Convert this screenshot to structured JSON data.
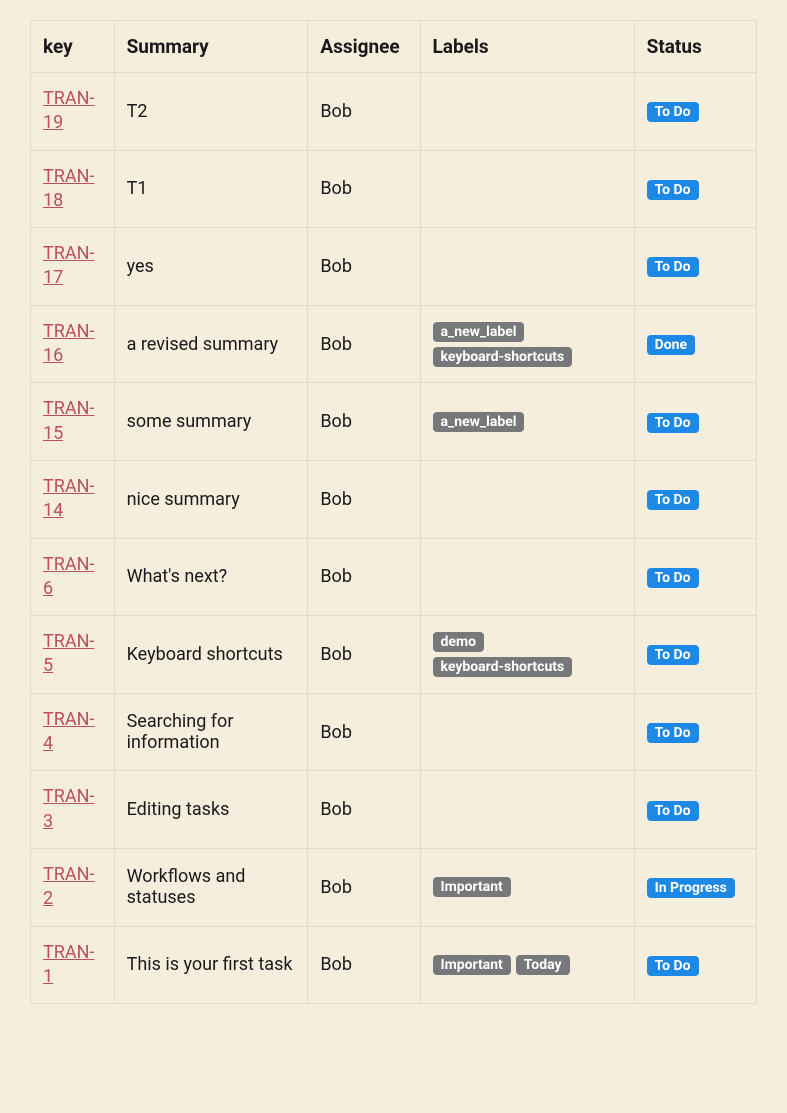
{
  "columns": {
    "key": "key",
    "summary": "Summary",
    "assignee": "Assignee",
    "labels": "Labels",
    "status": "Status"
  },
  "status_labels": {
    "todo": "To Do",
    "done": "Done",
    "in_progress": "In Progress"
  },
  "rows": [
    {
      "key": "TRAN-19",
      "summary": "T2",
      "assignee": "Bob",
      "labels": [],
      "status": "todo"
    },
    {
      "key": "TRAN-18",
      "summary": "T1",
      "assignee": "Bob",
      "labels": [],
      "status": "todo"
    },
    {
      "key": "TRAN-17",
      "summary": "yes",
      "assignee": "Bob",
      "labels": [],
      "status": "todo"
    },
    {
      "key": "TRAN-16",
      "summary": "a revised summary",
      "assignee": "Bob",
      "labels": [
        "a_new_label",
        "keyboard-shortcuts"
      ],
      "status": "done"
    },
    {
      "key": "TRAN-15",
      "summary": "some summary",
      "assignee": "Bob",
      "labels": [
        "a_new_label"
      ],
      "status": "todo"
    },
    {
      "key": "TRAN-14",
      "summary": "nice summary",
      "assignee": "Bob",
      "labels": [],
      "status": "todo"
    },
    {
      "key": "TRAN-6",
      "summary": "What's next?",
      "assignee": "Bob",
      "labels": [],
      "status": "todo"
    },
    {
      "key": "TRAN-5",
      "summary": "Keyboard shortcuts",
      "assignee": "Bob",
      "labels": [
        "demo",
        "keyboard-shortcuts"
      ],
      "status": "todo"
    },
    {
      "key": "TRAN-4",
      "summary": "Searching for information",
      "assignee": "Bob",
      "labels": [],
      "status": "todo"
    },
    {
      "key": "TRAN-3",
      "summary": "Editing tasks",
      "assignee": "Bob",
      "labels": [],
      "status": "todo"
    },
    {
      "key": "TRAN-2",
      "summary": "Workflows and statuses",
      "assignee": "Bob",
      "labels": [
        "Important"
      ],
      "status": "in_progress"
    },
    {
      "key": "TRAN-1",
      "summary": "This is your first task",
      "assignee": "Bob",
      "labels": [
        "Important",
        "Today"
      ],
      "status": "todo"
    }
  ]
}
